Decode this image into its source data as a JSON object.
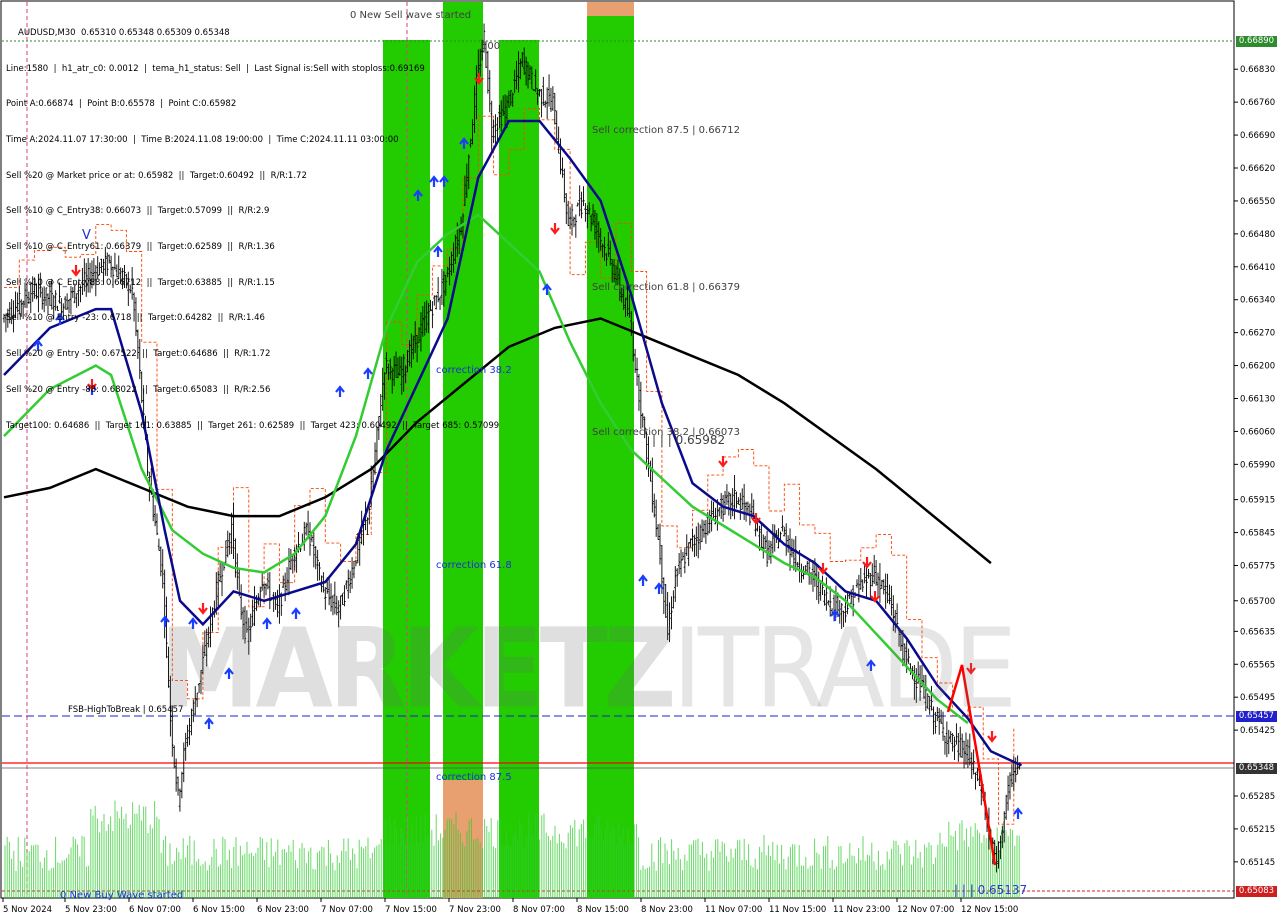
{
  "header": {
    "symbol_line": "AUDUSD,M30  0.65310 0.65348 0.65309 0.65348",
    "info_lines": [
      "Line:1580  |  h1_atr_c0: 0.0012  |  tema_h1_status: Sell  |  Last Signal is:Sell with stoploss:0.69169",
      "Point A:0.66874  |  Point B:0.65578  |  Point C:0.65982",
      "Time A:2024.11.07 17:30:00  |  Time B:2024.11.08 19:00:00  |  Time C:2024.11.11 03:00:00",
      "Sell %20 @ Market price or at: 0.65982  ||  Target:0.60492  ||  R/R:1.72",
      "Sell %10 @ C_Entry38: 0.66073  ||  Target:0.57099  ||  R/R:2.9",
      "Sell %10 @ C_Entry61: 0.66379  ||  Target:0.62589  ||  R/R:1.36",
      "Sell %10 @ C_Entry88: 0.66712  ||  Target:0.63885  ||  R/R:1.15",
      "Sell %10 @ Entry -23: 0.6718  ||  Target:0.64282  ||  R/R:1.46",
      "Sell %20 @ Entry -50: 0.67522  ||  Target:0.64686  ||  R/R:1.72",
      "Sell %20 @ Entry -88: 0.68022  ||  Target:0.65083  ||  R/R:2.56",
      "Target100: 0.64686  ||  Target 161: 0.63885  ||  Target 261: 0.62589  ||  Target 423: 0.60492  ||  Target 685: 0.57099"
    ]
  },
  "annotations": {
    "new_sell_wave": "0 New Sell wave started",
    "new_buy_wave": "0 New Buy Wave started",
    "hundred": "100",
    "correction_382": "correction 38.2",
    "correction_618": "correction 61.8",
    "correction_875": "correction 87.5",
    "sell_correction_875": "Sell correction 87.5 | 0.66712",
    "sell_correction_618": "Sell correction 61.8 | 0.66379",
    "sell_correction_382": "Sell correction 38.2 | 0.66073",
    "point_c_label": "| | | 0.65982",
    "low_label": "| | | 0.65137",
    "fsb_label": "FSB-HighToBreak | 0.65457",
    "v_marker": "V"
  },
  "watermark": {
    "bold": "MARKETZ",
    "thin": "ITRADE"
  },
  "price_tags": {
    "top": "0.66890",
    "fsb": "0.65457",
    "current": "0.65348",
    "bottom": "0.65083"
  },
  "colors": {
    "green_zone": "#22cc00",
    "orange_zone": "#e8a070",
    "ema_navy": "#0a0a8c",
    "ema_green": "#33cc33",
    "ema_black": "#000000",
    "stop_red_dashed": "#ff4400",
    "buy_arrow": "#1a3dff",
    "sell_arrow": "#ff1a1a",
    "volume": "#33cc33",
    "fsb_line": "#2020cc",
    "current_line": "#ff0000"
  },
  "chart_data": {
    "type": "candlestick",
    "symbol": "AUDUSD",
    "timeframe": "M30",
    "ylim": [
      0.65083,
      0.6689
    ],
    "y_ticks": [
      0.6683,
      0.6676,
      0.6669,
      0.6662,
      0.6655,
      0.6648,
      0.6641,
      0.6634,
      0.6627,
      0.662,
      0.6613,
      0.6606,
      0.6599,
      0.65915,
      0.65845,
      0.65775,
      0.657,
      0.65635,
      0.65565,
      0.65495,
      0.65425,
      0.65285,
      0.65215,
      0.65145
    ],
    "y_tick_labels": [
      "0.66830",
      "0.66760",
      "0.66690",
      "0.66620",
      "0.66550",
      "0.66480",
      "0.66410",
      "0.66340",
      "0.66270",
      "0.66200",
      "0.66130",
      "0.66060",
      "0.65990",
      "0.65915",
      "0.65845",
      "0.65775",
      "0.65700",
      "0.65635",
      "0.65565",
      "0.65495",
      "0.65425",
      "0.65285",
      "0.65215",
      "0.65145"
    ],
    "x_tick_labels": [
      "5 Nov 2024",
      "5 Nov 23:00",
      "6 Nov 07:00",
      "6 Nov 15:00",
      "6 Nov 23:00",
      "7 Nov 07:00",
      "7 Nov 15:00",
      "7 Nov 23:00",
      "8 Nov 07:00",
      "8 Nov 15:00",
      "8 Nov 23:00",
      "11 Nov 07:00",
      "11 Nov 15:00",
      "11 Nov 23:00",
      "12 Nov 07:00",
      "12 Nov 15:00"
    ],
    "levels": {
      "point_a": 0.66874,
      "point_b": 0.65578,
      "point_c": 0.65982,
      "sell_correction_875": 0.66712,
      "sell_correction_618": 0.66379,
      "sell_correction_382": 0.66073,
      "fsb_high_to_break": 0.65457,
      "current_price": 0.65348,
      "recent_low": 0.65137,
      "target_bottom": 0.65083
    },
    "price_path": [
      [
        0,
        0.663
      ],
      [
        4,
        0.6636
      ],
      [
        8,
        0.6633
      ],
      [
        12,
        0.664
      ],
      [
        14,
        0.6642
      ],
      [
        17,
        0.6636
      ],
      [
        18,
        0.6618
      ],
      [
        19,
        0.6598
      ],
      [
        21,
        0.6575
      ],
      [
        22,
        0.6545
      ],
      [
        23,
        0.6528
      ],
      [
        24,
        0.654
      ],
      [
        26,
        0.6555
      ],
      [
        28,
        0.6572
      ],
      [
        30,
        0.6586
      ],
      [
        31,
        0.657
      ],
      [
        32,
        0.6562
      ],
      [
        34,
        0.6575
      ],
      [
        36,
        0.6568
      ],
      [
        38,
        0.658
      ],
      [
        40,
        0.6585
      ],
      [
        42,
        0.6572
      ],
      [
        44,
        0.6568
      ],
      [
        46,
        0.6578
      ],
      [
        48,
        0.659
      ],
      [
        50,
        0.662
      ],
      [
        52,
        0.6618
      ],
      [
        54,
        0.6625
      ],
      [
        56,
        0.6632
      ],
      [
        58,
        0.6638
      ],
      [
        60,
        0.665
      ],
      [
        62,
        0.668
      ],
      [
        63,
        0.669
      ],
      [
        64,
        0.667
      ],
      [
        66,
        0.6675
      ],
      [
        68,
        0.6685
      ],
      [
        70,
        0.6678
      ],
      [
        72,
        0.6676
      ],
      [
        74,
        0.665
      ],
      [
        76,
        0.6655
      ],
      [
        78,
        0.6648
      ],
      [
        80,
        0.664
      ],
      [
        82,
        0.663
      ],
      [
        84,
        0.6605
      ],
      [
        86,
        0.658
      ],
      [
        87,
        0.6563
      ],
      [
        88,
        0.6575
      ],
      [
        90,
        0.6582
      ],
      [
        92,
        0.6586
      ],
      [
        94,
        0.659
      ],
      [
        96,
        0.6592
      ],
      [
        98,
        0.6588
      ],
      [
        100,
        0.658
      ],
      [
        102,
        0.6585
      ],
      [
        104,
        0.6578
      ],
      [
        106,
        0.6575
      ],
      [
        108,
        0.657
      ],
      [
        110,
        0.6568
      ],
      [
        112,
        0.6573
      ],
      [
        114,
        0.6576
      ],
      [
        116,
        0.657
      ],
      [
        118,
        0.6558
      ],
      [
        120,
        0.6552
      ],
      [
        122,
        0.6545
      ],
      [
        124,
        0.654
      ],
      [
        126,
        0.6538
      ],
      [
        128,
        0.653
      ],
      [
        129,
        0.652
      ],
      [
        130,
        0.6514
      ],
      [
        131,
        0.6525
      ],
      [
        132,
        0.6533
      ],
      [
        133,
        0.6535
      ]
    ],
    "ema_fast": [
      [
        0,
        0.6618
      ],
      [
        6,
        0.6628
      ],
      [
        12,
        0.6632
      ],
      [
        14,
        0.6632
      ],
      [
        18,
        0.661
      ],
      [
        21,
        0.6585
      ],
      [
        23,
        0.657
      ],
      [
        26,
        0.6565
      ],
      [
        30,
        0.6572
      ],
      [
        34,
        0.657
      ],
      [
        38,
        0.6572
      ],
      [
        42,
        0.6574
      ],
      [
        46,
        0.6582
      ],
      [
        50,
        0.6602
      ],
      [
        54,
        0.6616
      ],
      [
        58,
        0.663
      ],
      [
        62,
        0.666
      ],
      [
        66,
        0.6672
      ],
      [
        70,
        0.6672
      ],
      [
        74,
        0.6664
      ],
      [
        78,
        0.6655
      ],
      [
        82,
        0.6635
      ],
      [
        86,
        0.6612
      ],
      [
        90,
        0.6595
      ],
      [
        94,
        0.659
      ],
      [
        98,
        0.6588
      ],
      [
        102,
        0.6582
      ],
      [
        106,
        0.6578
      ],
      [
        110,
        0.6572
      ],
      [
        114,
        0.657
      ],
      [
        118,
        0.6562
      ],
      [
        122,
        0.6552
      ],
      [
        126,
        0.6545
      ],
      [
        129,
        0.6538
      ],
      [
        133,
        0.6535
      ]
    ],
    "ema_mid": [
      [
        0,
        0.6605
      ],
      [
        6,
        0.6615
      ],
      [
        12,
        0.662
      ],
      [
        14,
        0.6618
      ],
      [
        18,
        0.6598
      ],
      [
        22,
        0.6585
      ],
      [
        26,
        0.658
      ],
      [
        30,
        0.6577
      ],
      [
        34,
        0.6576
      ],
      [
        38,
        0.658
      ],
      [
        42,
        0.6588
      ],
      [
        46,
        0.6605
      ],
      [
        50,
        0.6628
      ],
      [
        54,
        0.6642
      ],
      [
        58,
        0.6648
      ],
      [
        62,
        0.6652
      ],
      [
        66,
        0.6646
      ],
      [
        70,
        0.664
      ],
      [
        74,
        0.6625
      ],
      [
        78,
        0.6612
      ],
      [
        82,
        0.6602
      ],
      [
        86,
        0.6596
      ],
      [
        90,
        0.659
      ],
      [
        94,
        0.6586
      ],
      [
        98,
        0.6582
      ],
      [
        102,
        0.6578
      ],
      [
        106,
        0.6575
      ],
      [
        110,
        0.657
      ],
      [
        114,
        0.6563
      ],
      [
        118,
        0.6556
      ],
      [
        122,
        0.6549
      ],
      [
        126,
        0.6544
      ]
    ],
    "ema_slow": [
      [
        0,
        0.6592
      ],
      [
        6,
        0.6594
      ],
      [
        12,
        0.6598
      ],
      [
        18,
        0.6594
      ],
      [
        24,
        0.659
      ],
      [
        30,
        0.6588
      ],
      [
        36,
        0.6588
      ],
      [
        42,
        0.6592
      ],
      [
        48,
        0.6598
      ],
      [
        54,
        0.6608
      ],
      [
        60,
        0.6616
      ],
      [
        66,
        0.6624
      ],
      [
        72,
        0.6628
      ],
      [
        78,
        0.663
      ],
      [
        84,
        0.6626
      ],
      [
        90,
        0.6622
      ],
      [
        96,
        0.6618
      ],
      [
        102,
        0.6612
      ],
      [
        108,
        0.6605
      ],
      [
        114,
        0.6598
      ],
      [
        120,
        0.659
      ],
      [
        126,
        0.6582
      ],
      [
        129,
        0.6578
      ]
    ],
    "volume_bars_source": "bottom histogram",
    "green_zones_x_ranges_px": [],
    "signals": {
      "buy_arrows_count": 22,
      "sell_arrows_count": 11
    }
  }
}
